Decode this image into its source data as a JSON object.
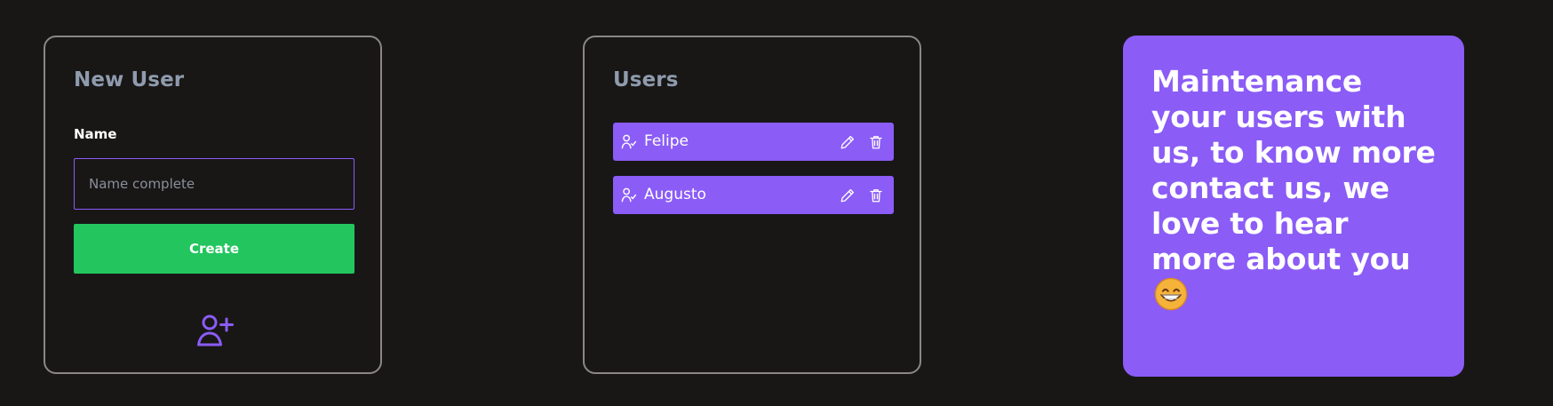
{
  "new_user_panel": {
    "title": "New User",
    "name_label": "Name",
    "name_input": {
      "value": "",
      "placeholder": "Name complete"
    },
    "create_button_label": "Create",
    "add_user_icon": "user-plus-icon"
  },
  "users_panel": {
    "title": "Users",
    "items": [
      {
        "name": "Felipe",
        "icon": "user-check-icon",
        "edit_icon": "pencil-icon",
        "delete_icon": "trash-icon"
      },
      {
        "name": "Augusto",
        "icon": "user-check-icon",
        "edit_icon": "pencil-icon",
        "delete_icon": "trash-icon"
      }
    ]
  },
  "message_panel": {
    "text": "Maintenance your users with us, to know more contact us, we love to hear more about you",
    "emoji_icon": "grinning-face-icon"
  },
  "colors": {
    "background": "#181716",
    "card_border": "#8a8784",
    "title": "#8f9bad",
    "accent": "#8b5cf6",
    "create_button": "#22c55e",
    "text": "#ffffff",
    "emoji_yellow": "#f6b33a"
  }
}
